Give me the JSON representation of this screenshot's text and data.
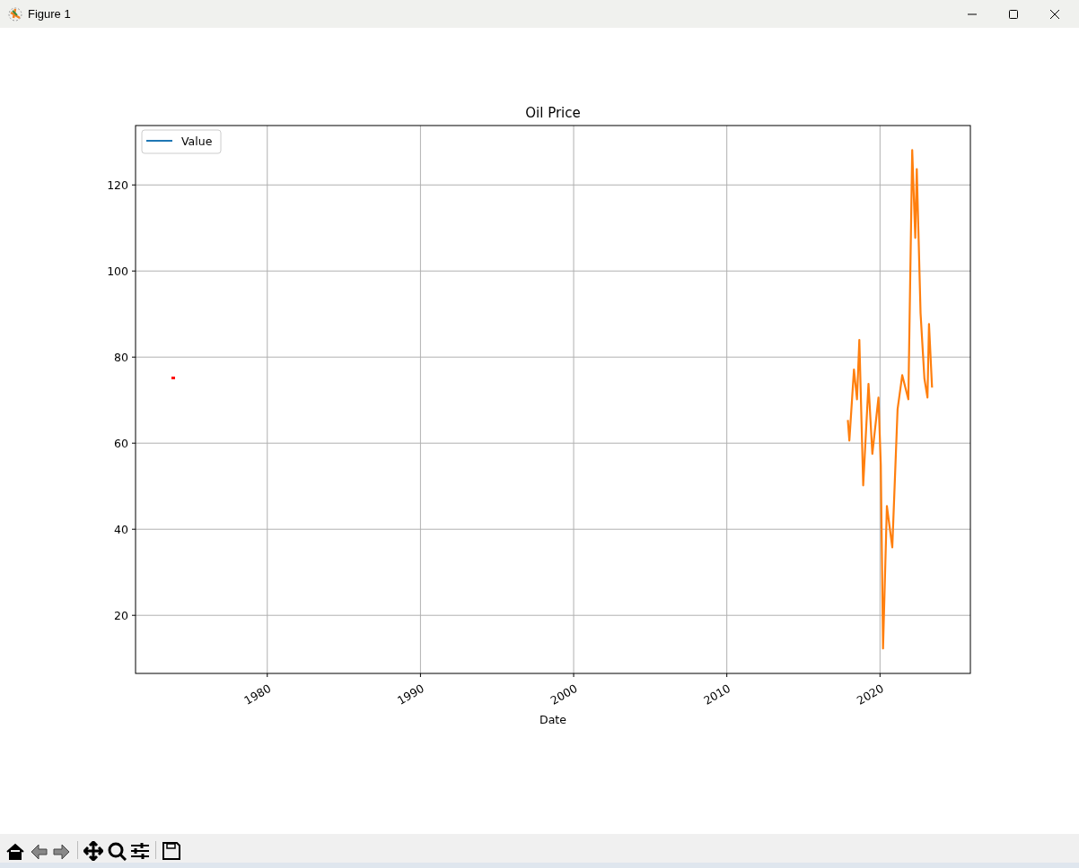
{
  "window": {
    "title": "Figure 1"
  },
  "figure": {
    "chart_data": {
      "type": "line",
      "grid": true,
      "title": "Oil Price",
      "xlabel": "Date",
      "xlim": [
        1971.4,
        2025.9
      ],
      "ylim": [
        6.5,
        133.8
      ],
      "xticks": [
        {
          "value": 1980,
          "label": "1980"
        },
        {
          "value": 1990,
          "label": "1990"
        },
        {
          "value": 2000,
          "label": "2000"
        },
        {
          "value": 2010,
          "label": "2010"
        },
        {
          "value": 2020,
          "label": "2020"
        }
      ],
      "yticks": [
        {
          "value": 20,
          "label": "20"
        },
        {
          "value": 40,
          "label": "40"
        },
        {
          "value": 60,
          "label": "60"
        },
        {
          "value": 80,
          "label": "80"
        },
        {
          "value": 100,
          "label": "100"
        },
        {
          "value": 120,
          "label": "120"
        }
      ],
      "x": [
        1973.85,
        2017.9,
        2018.0,
        2018.3,
        2018.5,
        2018.65,
        2018.9,
        2019.25,
        2019.5,
        2019.9,
        2020.05,
        2020.2,
        2020.45,
        2020.8,
        2021.15,
        2021.45,
        2021.85,
        2022.1,
        2022.3,
        2022.4,
        2022.65,
        2022.9,
        2023.1,
        2023.2,
        2023.4
      ],
      "series": [
        {
          "name": "Value",
          "color": "#1f77b4",
          "values": [
            null,
            null,
            null,
            null,
            null,
            null,
            null,
            null,
            null,
            null,
            null,
            null,
            null,
            null,
            null,
            null,
            null,
            null,
            null,
            null,
            null,
            null,
            null,
            null,
            null
          ]
        },
        {
          "color": "#ff7f0e",
          "values": [
            null,
            65.4,
            60.6,
            77.1,
            70.2,
            84,
            50.2,
            73.8,
            57.5,
            70.6,
            55,
            12.3,
            45.4,
            35.8,
            67.9,
            75.8,
            70.2,
            128.1,
            107.7,
            123.7,
            90.2,
            75,
            70.6,
            87.7,
            72.9
          ]
        },
        {
          "color": "#ff0000",
          "marker": "square",
          "values": [
            75.2,
            null,
            null,
            null,
            null,
            null,
            null,
            null,
            null,
            null,
            null,
            null,
            null,
            null,
            null,
            null,
            null,
            null,
            null,
            null,
            null,
            null,
            null,
            null,
            null
          ]
        }
      ]
    }
  }
}
